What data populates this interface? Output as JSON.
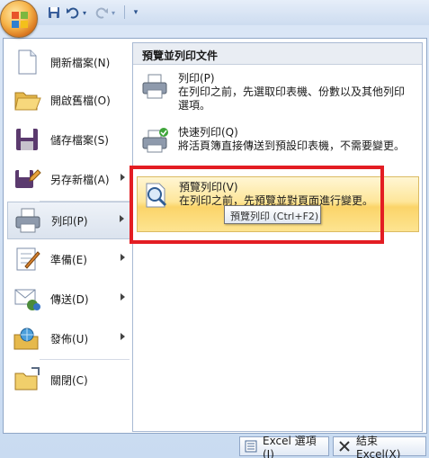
{
  "qat": {
    "icons": [
      "save-icon",
      "undo-icon",
      "redo-icon",
      "customize-qat-icon"
    ]
  },
  "left_menu": {
    "items": [
      {
        "label": "開新檔案(N)",
        "icon": "new-document-icon"
      },
      {
        "label": "開啟舊檔(O)",
        "icon": "open-folder-icon"
      },
      {
        "label": "儲存檔案(S)",
        "icon": "save-icon"
      },
      {
        "label": "另存新檔(A)",
        "icon": "save-as-icon"
      },
      {
        "label": "列印(P)",
        "icon": "print-icon"
      },
      {
        "label": "準備(E)",
        "icon": "prepare-icon"
      },
      {
        "label": "傳送(D)",
        "icon": "send-icon"
      },
      {
        "label": "發佈(U)",
        "icon": "publish-icon"
      },
      {
        "label": "關閉(C)",
        "icon": "close-folder-icon"
      }
    ]
  },
  "right_panel": {
    "heading": "預覽並列印文件",
    "items": [
      {
        "title": "列印(P)",
        "desc": "在列印之前，先選取印表機、份數以及其他列印選項。",
        "icon": "printer-icon"
      },
      {
        "title": "快速列印(Q)",
        "desc": "將活頁簿直接傳送到預設印表機，不需要變更。",
        "icon": "quick-print-icon"
      },
      {
        "title": "預覽列印(V)",
        "desc": "在列印之前，先預覽並對頁面進行變更。",
        "icon": "print-preview-icon"
      }
    ]
  },
  "tooltip": "預覽列印 (Ctrl+F2)",
  "bottom": {
    "options_label": "Excel 選項(I)",
    "exit_label": "結束 Excel(X)"
  },
  "colors": {
    "highlight_border": "#e31d23",
    "hover_fill": "#fbd469"
  }
}
